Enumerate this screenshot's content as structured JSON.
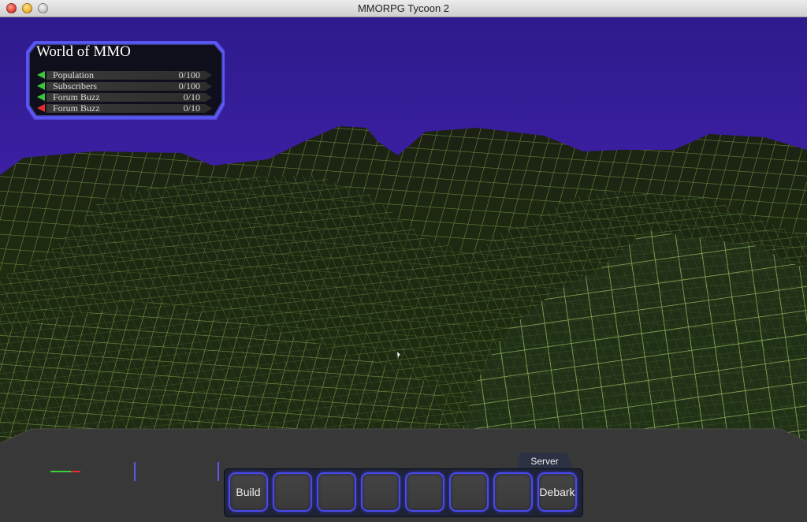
{
  "window": {
    "title": "MMORPG Tycoon 2"
  },
  "colors": {
    "sky_top": "#2e1a8c",
    "sky_bottom": "#5a2bd6",
    "terrain_grid": "#b7e07a",
    "terrain_dark": "#1a2410",
    "panel_border": "#3c3cff",
    "hud_base": "#373737",
    "slot_border": "#4a4ae8"
  },
  "stats_panel": {
    "title": "World of MMO",
    "rows": [
      {
        "label": "Population",
        "value": "0/100",
        "trend": "up",
        "color": "green"
      },
      {
        "label": "Subscribers",
        "value": "0/100",
        "trend": "up",
        "color": "green"
      },
      {
        "label": "Forum Buzz",
        "value": "0/10",
        "trend": "up",
        "color": "green"
      },
      {
        "label": "Forum Buzz",
        "value": "0/10",
        "trend": "down",
        "color": "red"
      }
    ]
  },
  "toolbar": {
    "tab_label": "Server",
    "slots": [
      {
        "label": "Build"
      },
      {
        "label": ""
      },
      {
        "label": ""
      },
      {
        "label": ""
      },
      {
        "label": ""
      },
      {
        "label": ""
      },
      {
        "label": ""
      },
      {
        "label": "Debark"
      }
    ]
  }
}
